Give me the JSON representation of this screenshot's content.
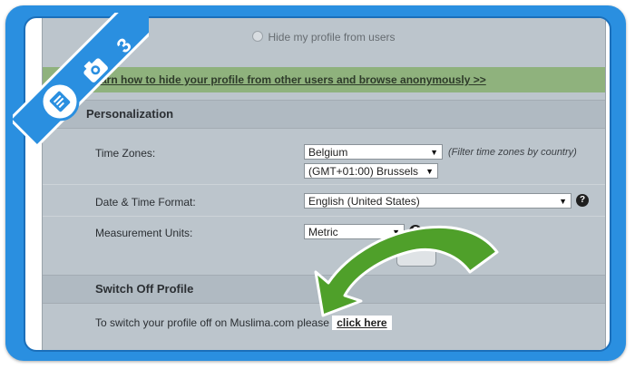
{
  "logo": {
    "step_number": "3"
  },
  "privacy": {
    "hide_option_label": "Hide my profile from users",
    "green_link": "Learn how to hide your profile from other users and browse anonymously >>"
  },
  "localization": {
    "section_title": "Personalization",
    "time_zones_label": "Time Zones:",
    "country_value": "Belgium",
    "timezone_value": "(GMT+01:00) Brussels",
    "filter_hint": "(Filter time zones by country)",
    "date_format_label": "Date & Time Format:",
    "date_format_value": "English (United States)",
    "units_label": "Measurement Units:",
    "units_value": "Metric",
    "help_glyph": "?"
  },
  "switch_off": {
    "section_title": "Switch Off Profile",
    "text": "To switch your profile off on Muslima.com please",
    "link": "click here"
  },
  "colors": {
    "frame_blue": "#2a8fe0",
    "arrow_green": "#4fa02a",
    "info_bar_green": "#8fb27d"
  }
}
